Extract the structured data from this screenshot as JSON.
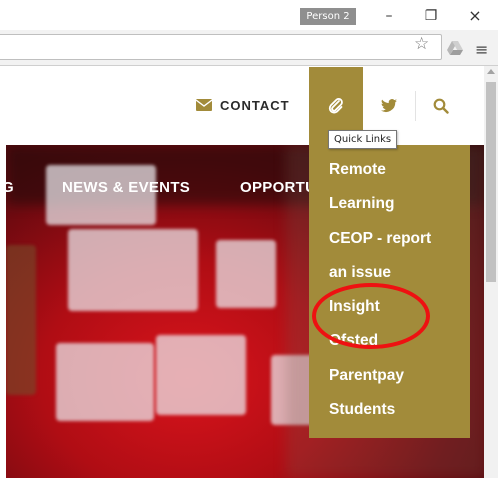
{
  "browser": {
    "profile_label": "Person 2",
    "minimize_glyph": "–",
    "restore_glyph": "❐",
    "close_glyph": "×",
    "star_glyph": "☆",
    "menu_glyph": "≡"
  },
  "header": {
    "contact_label": "CONTACT",
    "icons": [
      "envelope-icon",
      "paperclip-icon",
      "twitter-icon",
      "search-icon"
    ]
  },
  "nav": {
    "items": [
      "G",
      "NEWS & EVENTS",
      "OPPORTU"
    ]
  },
  "quick_links": {
    "tooltip": "Quick Links",
    "items": [
      "Remote",
      "Learning",
      "CEOP - report",
      "an issue",
      "Insight",
      "Ofsted",
      "Parentpay",
      "Students"
    ]
  },
  "colors": {
    "accent_gold": "#a28b3a",
    "hero_red": "#d9141c",
    "annotation_red": "#ee1111"
  }
}
